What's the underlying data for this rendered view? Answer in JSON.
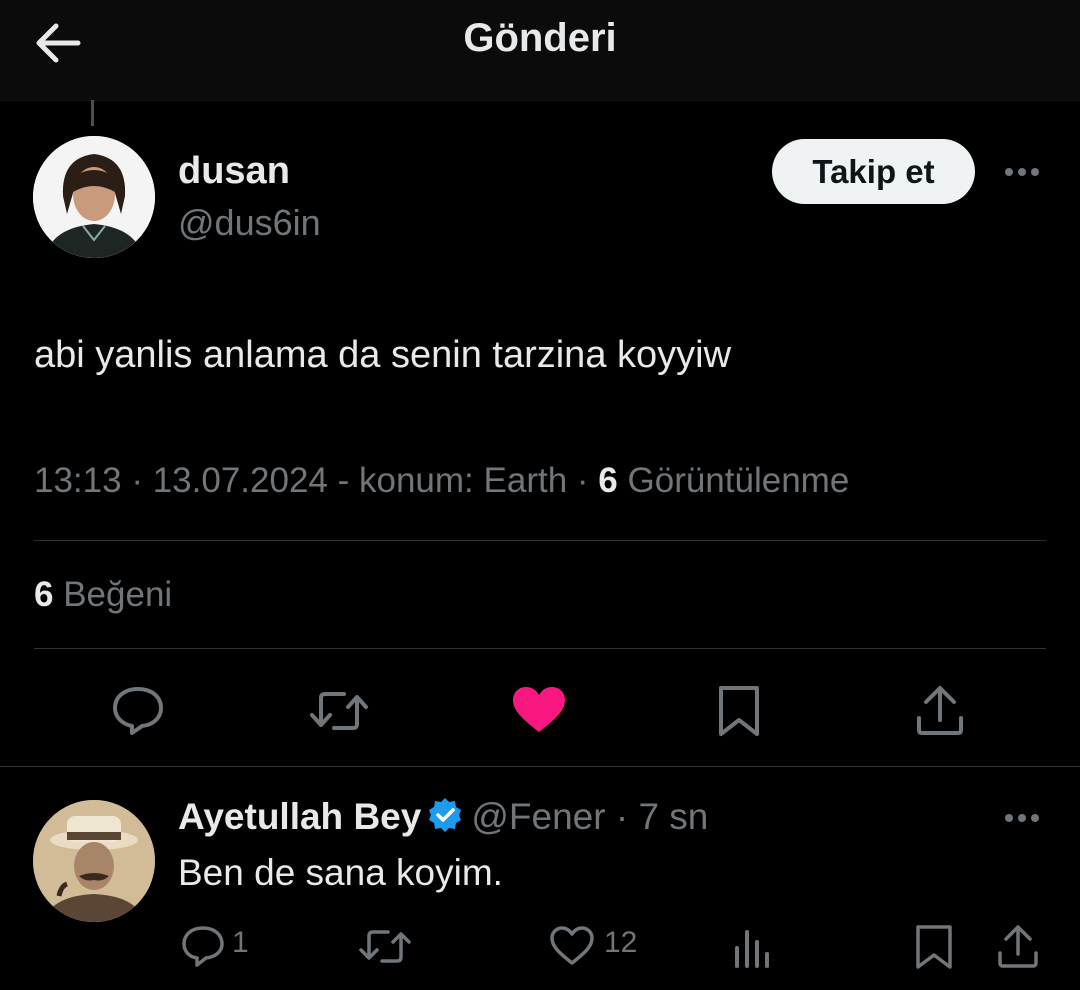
{
  "header": {
    "title": "Gönderi",
    "back_icon": "arrow-left-icon"
  },
  "tweet": {
    "author_name": "dusan",
    "author_handle": "@dus6in",
    "follow_label": "Takip et",
    "text": "abi yanlis anlama da senin tarzina koyyiw",
    "time": "13:13",
    "date": "13.07.2024",
    "location": "- konum: Earth",
    "views_count": "6",
    "views_label": "Görüntülenme",
    "likes_count": "6",
    "likes_label": "Beğeni",
    "liked": true,
    "like_color": "#f91880"
  },
  "reply": {
    "author_name": "Ayetullah Bey",
    "author_handle": "@Fener",
    "time": "7 sn",
    "text": "Ben de sana koyim.",
    "reply_count": "1",
    "like_count": "12",
    "verified_color": "#1d9bf0"
  },
  "icons": [
    "arrow-left-icon",
    "more-icon",
    "reply-icon",
    "retweet-icon",
    "heart-icon",
    "bookmark-icon",
    "share-icon",
    "analytics-icon",
    "verified-badge-icon"
  ]
}
